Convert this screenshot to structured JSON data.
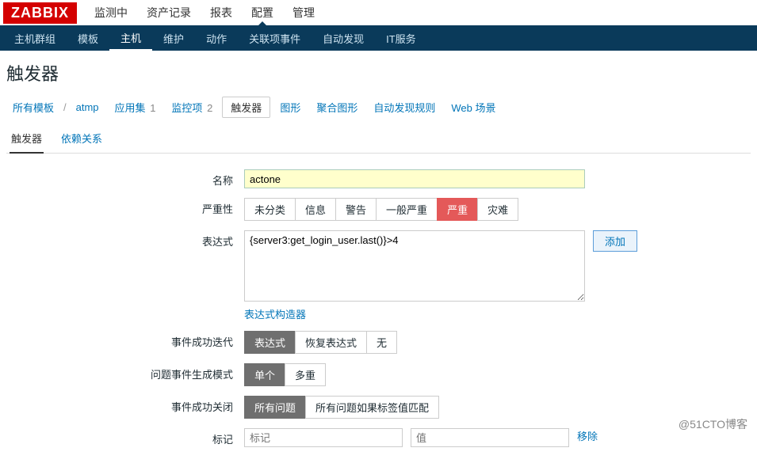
{
  "logo": "ZABBIX",
  "topnav": {
    "items": [
      "监测中",
      "资产记录",
      "报表",
      "配置",
      "管理"
    ],
    "activeIndex": 3
  },
  "subnav": {
    "items": [
      "主机群组",
      "模板",
      "主机",
      "维护",
      "动作",
      "关联项事件",
      "自动发现",
      "IT服务"
    ],
    "activeIndex": 2
  },
  "title": "触发器",
  "crumbs": {
    "allTemplates": "所有模板",
    "template": "atmp",
    "apps": {
      "label": "应用集",
      "count": "1"
    },
    "items": {
      "label": "监控项",
      "count": "2"
    },
    "triggers": "触发器",
    "graphs": "图形",
    "aggGraphs": "聚合图形",
    "discovery": "自动发现规则",
    "web": "Web 场景"
  },
  "subtabs": {
    "a": "触发器",
    "b": "依赖关系",
    "activeIndex": 0
  },
  "labels": {
    "name": "名称",
    "severity": "严重性",
    "expression": "表达式",
    "exprBuilder": "表达式构造器",
    "okIter": "事件成功迭代",
    "problemMode": "问题事件生成模式",
    "okClose": "事件成功关闭",
    "tags": "标记"
  },
  "values": {
    "name": "actone",
    "expression": "{server3:get_login_user.last()}>4",
    "tagName": "",
    "tagValue": ""
  },
  "placeholders": {
    "tagName": "标记",
    "tagValue": "值"
  },
  "severity": {
    "opts": [
      "未分类",
      "信息",
      "警告",
      "一般严重",
      "严重",
      "灾难"
    ],
    "selected": 4
  },
  "okIter": {
    "opts": [
      "表达式",
      "恢复表达式",
      "无"
    ],
    "selected": 0
  },
  "problemMode": {
    "opts": [
      "单个",
      "多重"
    ],
    "selected": 0
  },
  "okClose": {
    "opts": [
      "所有问题",
      "所有问题如果标签值匹配"
    ],
    "selected": 0
  },
  "buttons": {
    "add": "添加",
    "remove": "移除"
  },
  "watermark": "@51CTO博客"
}
